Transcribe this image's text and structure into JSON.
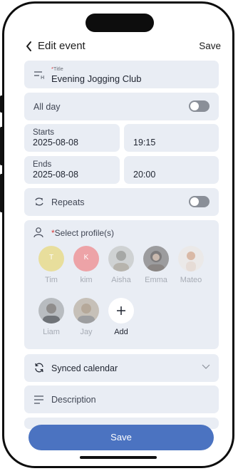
{
  "header": {
    "title": "Edit event",
    "save_label": "Save"
  },
  "title_field": {
    "label": "Title",
    "value": "Evening Jogging Club"
  },
  "all_day": {
    "label": "All day",
    "enabled": false
  },
  "starts": {
    "label": "Starts",
    "date": "2025-08-08",
    "time": "19:15"
  },
  "ends": {
    "label": "Ends",
    "date": "2025-08-08",
    "time": "20:00"
  },
  "repeats": {
    "label": "Repeats",
    "enabled": false
  },
  "profiles": {
    "label": "Select profile(s)",
    "items": [
      {
        "name": "Tim",
        "initial": "T",
        "color": "#e8de9c"
      },
      {
        "name": "kim",
        "initial": "K",
        "color": "#eda3a7"
      },
      {
        "name": "Aisha"
      },
      {
        "name": "Emma"
      },
      {
        "name": "Mateo"
      },
      {
        "name": "Liam"
      },
      {
        "name": "Jay"
      }
    ],
    "add_label": "Add"
  },
  "calendar": {
    "label": "Synced calendar"
  },
  "description": {
    "label": "Description"
  },
  "footer": {
    "save_label": "Save"
  },
  "colors": {
    "accent": "#4b73c1",
    "card": "#e9edf4",
    "required": "#d63a3a"
  }
}
